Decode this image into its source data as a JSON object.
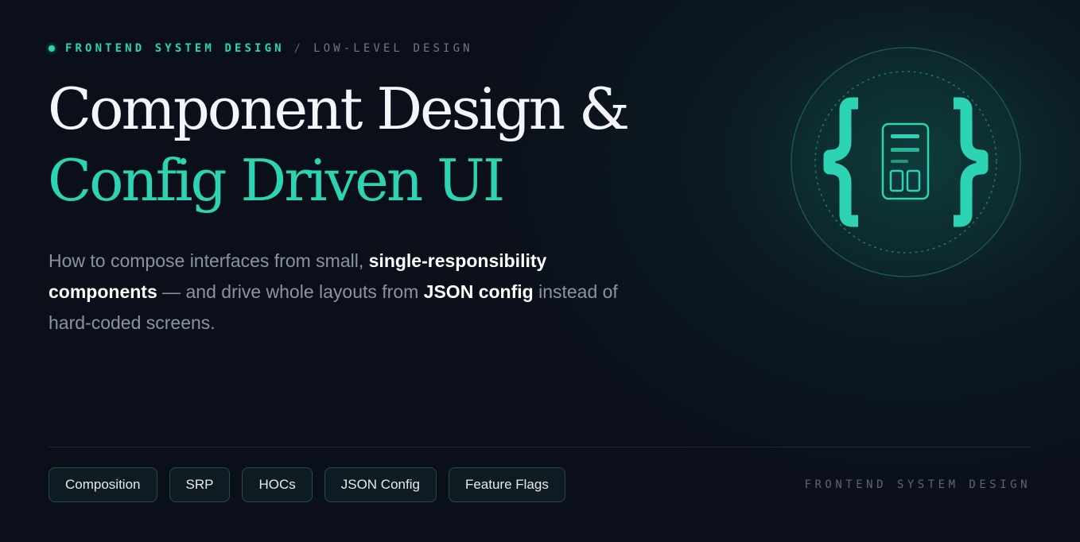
{
  "header": {
    "eyebrow_primary": "FRONTEND SYSTEM DESIGN",
    "eyebrow_separator": "/",
    "eyebrow_secondary": "LOW-LEVEL DESIGN"
  },
  "hero": {
    "title_line1": "Component Design &",
    "title_line2": "Config Driven UI",
    "subtitle": {
      "part1": "How to compose interfaces from small, ",
      "bold1": "single-responsibility components",
      "part2": " — and drive whole layouts from ",
      "bold2": "JSON config",
      "part3": " instead of hard-coded screens."
    }
  },
  "tags": [
    "Composition",
    "SRP",
    "HOCs",
    "JSON Config",
    "Feature Flags"
  ],
  "footer": {
    "label": "FRONTEND SYSTEM DESIGN"
  },
  "emblem": {
    "icon": "config-braces-icon"
  },
  "colors": {
    "background": "#0b0f1a",
    "accent": "#2dd4b4",
    "text_primary": "#f4f5f8",
    "text_muted": "#8b93a3"
  }
}
